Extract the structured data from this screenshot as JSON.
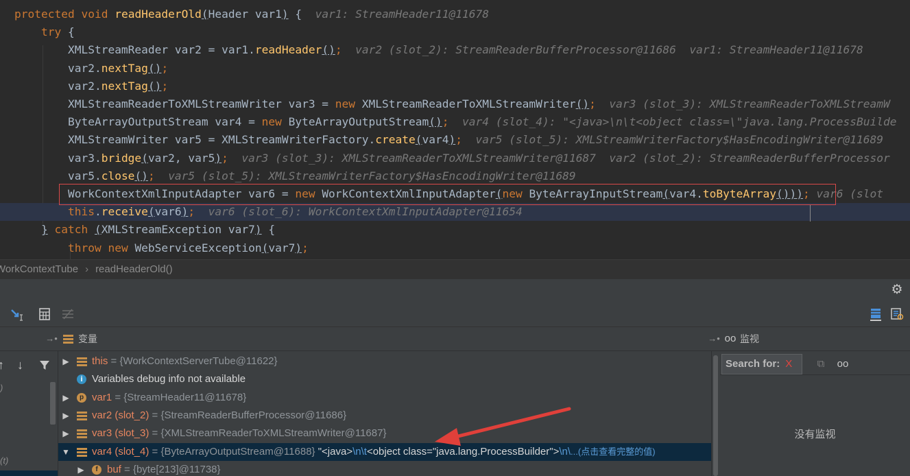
{
  "editor": {
    "lines": [
      {
        "indent": "",
        "tokens": [
          [
            "kw",
            "protected "
          ],
          [
            "kw",
            "void "
          ],
          [
            "me",
            "readHeaderOld"
          ],
          [
            "ul",
            "("
          ],
          [
            "tx",
            "Header var1"
          ],
          [
            "ul",
            ")"
          ],
          [
            "tx",
            " {  "
          ],
          [
            "hint",
            "var1: StreamHeader11@11678"
          ]
        ]
      },
      {
        "indent": "    ",
        "tokens": [
          [
            "kw",
            "try "
          ],
          [
            "tx",
            "{"
          ]
        ]
      },
      {
        "indent": "        ",
        "tokens": [
          [
            "tx",
            "XMLStreamReader var2 = var1."
          ],
          [
            "me",
            "readHeader"
          ],
          [
            "ul",
            "()"
          ],
          [
            "kw",
            ";"
          ],
          [
            "tx",
            "  "
          ],
          [
            "hint",
            "var2 (slot_2): StreamReaderBufferProcessor@11686  var1: StreamHeader11@11678"
          ]
        ]
      },
      {
        "indent": "        ",
        "tokens": [
          [
            "tx",
            "var2."
          ],
          [
            "me",
            "nextTag"
          ],
          [
            "ul",
            "()"
          ],
          [
            "kw",
            ";"
          ]
        ]
      },
      {
        "indent": "        ",
        "tokens": [
          [
            "tx",
            "var2."
          ],
          [
            "me",
            "nextTag"
          ],
          [
            "ul",
            "()"
          ],
          [
            "kw",
            ";"
          ]
        ]
      },
      {
        "indent": "        ",
        "tokens": [
          [
            "tx",
            "XMLStreamReaderToXMLStreamWriter var3 = "
          ],
          [
            "kw",
            "new "
          ],
          [
            "tx",
            "XMLStreamReaderToXMLStreamWriter"
          ],
          [
            "ul",
            "()"
          ],
          [
            "kw",
            ";"
          ],
          [
            "tx",
            "  "
          ],
          [
            "hint",
            "var3 (slot_3): XMLStreamReaderToXMLStreamW"
          ]
        ]
      },
      {
        "indent": "        ",
        "tokens": [
          [
            "tx",
            "ByteArrayOutputStream var4 = "
          ],
          [
            "kw",
            "new "
          ],
          [
            "tx",
            "ByteArrayOutputStream"
          ],
          [
            "ul",
            "()"
          ],
          [
            "kw",
            ";"
          ],
          [
            "tx",
            "  "
          ],
          [
            "hint",
            "var4 (slot_4): \"<java>\\n\\t<object class=\\\"java.lang.ProcessBuilde"
          ]
        ]
      },
      {
        "indent": "        ",
        "tokens": [
          [
            "tx",
            "XMLStreamWriter var5 = XMLStreamWriterFactory."
          ],
          [
            "me",
            "create"
          ],
          [
            "ul",
            "("
          ],
          [
            "tx",
            "var4"
          ],
          [
            "ul",
            ")"
          ],
          [
            "kw",
            ";"
          ],
          [
            "tx",
            "  "
          ],
          [
            "hint",
            "var5 (slot_5): XMLStreamWriterFactory$HasEncodingWriter@11689"
          ]
        ]
      },
      {
        "indent": "        ",
        "tokens": [
          [
            "tx",
            "var3."
          ],
          [
            "me",
            "bridge"
          ],
          [
            "ul",
            "("
          ],
          [
            "tx",
            "var2, var5"
          ],
          [
            "ul",
            ")"
          ],
          [
            "kw",
            ";"
          ],
          [
            "tx",
            "  "
          ],
          [
            "hint",
            "var3 (slot_3): XMLStreamReaderToXMLStreamWriter@11687  var2 (slot_2): StreamReaderBufferProcessor"
          ]
        ]
      },
      {
        "indent": "        ",
        "tokens": [
          [
            "tx",
            "var5."
          ],
          [
            "me",
            "close"
          ],
          [
            "ul",
            "()"
          ],
          [
            "kw",
            ";"
          ],
          [
            "tx",
            "  "
          ],
          [
            "hint",
            "var5 (slot_5): XMLStreamWriterFactory$HasEncodingWriter@11689"
          ]
        ]
      },
      {
        "indent": "        ",
        "tokens": [
          [
            "tx",
            "WorkContextXmlInputAdapter var6 = "
          ],
          [
            "kw",
            "new "
          ],
          [
            "tx",
            "WorkContextXmlInputAdapter"
          ],
          [
            "ul",
            "("
          ],
          [
            "kw",
            "new "
          ],
          [
            "tx",
            "ByteArrayInputStream"
          ],
          [
            "ul",
            "("
          ],
          [
            "tx",
            "var4."
          ],
          [
            "me",
            "toByteArray"
          ],
          [
            "ul",
            "()))"
          ],
          [
            "kw",
            ";"
          ],
          [
            "tx",
            " "
          ],
          [
            "hint",
            "var6 (slot"
          ]
        ]
      },
      {
        "indent": "        ",
        "tokens": [
          [
            "kw",
            "this"
          ],
          [
            "tx",
            "."
          ],
          [
            "me",
            "receive"
          ],
          [
            "ul",
            "("
          ],
          [
            "tx",
            "var6"
          ],
          [
            "ul",
            ")"
          ],
          [
            "kw",
            ";"
          ],
          [
            "tx",
            "  "
          ],
          [
            "hint",
            "var6 (slot_6): WorkContextXmlInputAdapter@11654"
          ]
        ]
      },
      {
        "indent": "    ",
        "tokens": [
          [
            "ul",
            "}"
          ],
          [
            "tx",
            " "
          ],
          [
            "kw",
            "catch "
          ],
          [
            "ul",
            "("
          ],
          [
            "tx",
            "XMLStreamException var7"
          ],
          [
            "ul",
            ")"
          ],
          [
            "tx",
            " {"
          ]
        ]
      },
      {
        "indent": "        ",
        "tokens": [
          [
            "kw",
            "throw "
          ],
          [
            "kw",
            "new "
          ],
          [
            "tx",
            "WebServiceException"
          ],
          [
            "ul",
            "("
          ],
          [
            "tx",
            "var7"
          ],
          [
            "ul",
            ")"
          ],
          [
            "kw",
            ";"
          ]
        ]
      }
    ]
  },
  "breadcrumb": {
    "class_name": "WorkContextTube",
    "separator": "›",
    "method_name": "readHeaderOld()"
  },
  "debugger": {
    "variables_label": "变量",
    "watches_label": "监视",
    "search_label": "Search for:",
    "search_clear": "X",
    "no_watches": "没有监视",
    "frame_hints": [
      ")",
      "(t)"
    ],
    "variables": [
      {
        "arrow": "▶",
        "icon": "field",
        "name": "this",
        "value": " = {WorkContextServerTube@11622}"
      },
      {
        "arrow": "",
        "icon": "info",
        "name": "",
        "value": "Variables debug info not available"
      },
      {
        "arrow": "▶",
        "icon": "p",
        "name": "var1",
        "value": " = {StreamHeader11@11678}"
      },
      {
        "arrow": "▶",
        "icon": "field",
        "name": "var2 (slot_2)",
        "value": " = {StreamReaderBufferProcessor@11686}"
      },
      {
        "arrow": "▶",
        "icon": "field",
        "name": "var3 (slot_3)",
        "value": " = {XMLStreamReaderToXMLStreamWriter@11687}"
      },
      {
        "arrow": "▼",
        "icon": "field",
        "name": "var4 (slot_4)",
        "value": " = {ByteArrayOutputStream@11688} ",
        "str_open": "\"<java>",
        "esc1": "\\n\\t",
        "str_mid": "<object class=\"java.lang.ProcessBuilder\">",
        "esc2": "\\n\\",
        "link": "...(点击查看完整的值)"
      },
      {
        "arrow": "▶",
        "icon": "f",
        "name": "buf",
        "value": " = {byte[213]@11738}"
      }
    ]
  },
  "colors": {
    "annotation_arrow": "#e0403a",
    "breakpoint_box": "#d94a4a",
    "selection": "#0d293e"
  }
}
